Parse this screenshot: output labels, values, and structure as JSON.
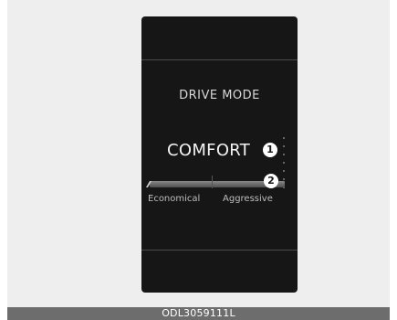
{
  "display": {
    "title": "DRIVE MODE",
    "selected_mode": "COMFORT",
    "callouts": [
      "1",
      "2"
    ],
    "slider": {
      "left_label": "Economical",
      "right_label": "Aggressive"
    }
  },
  "caption": "ODL3059111L",
  "colors": {
    "screen_bg": "#161616",
    "frame_bg": "#eeeeee",
    "caption_bg": "#6d6d6d",
    "text_primary": "#f2f2f2",
    "text_secondary": "#bdbdbd"
  }
}
